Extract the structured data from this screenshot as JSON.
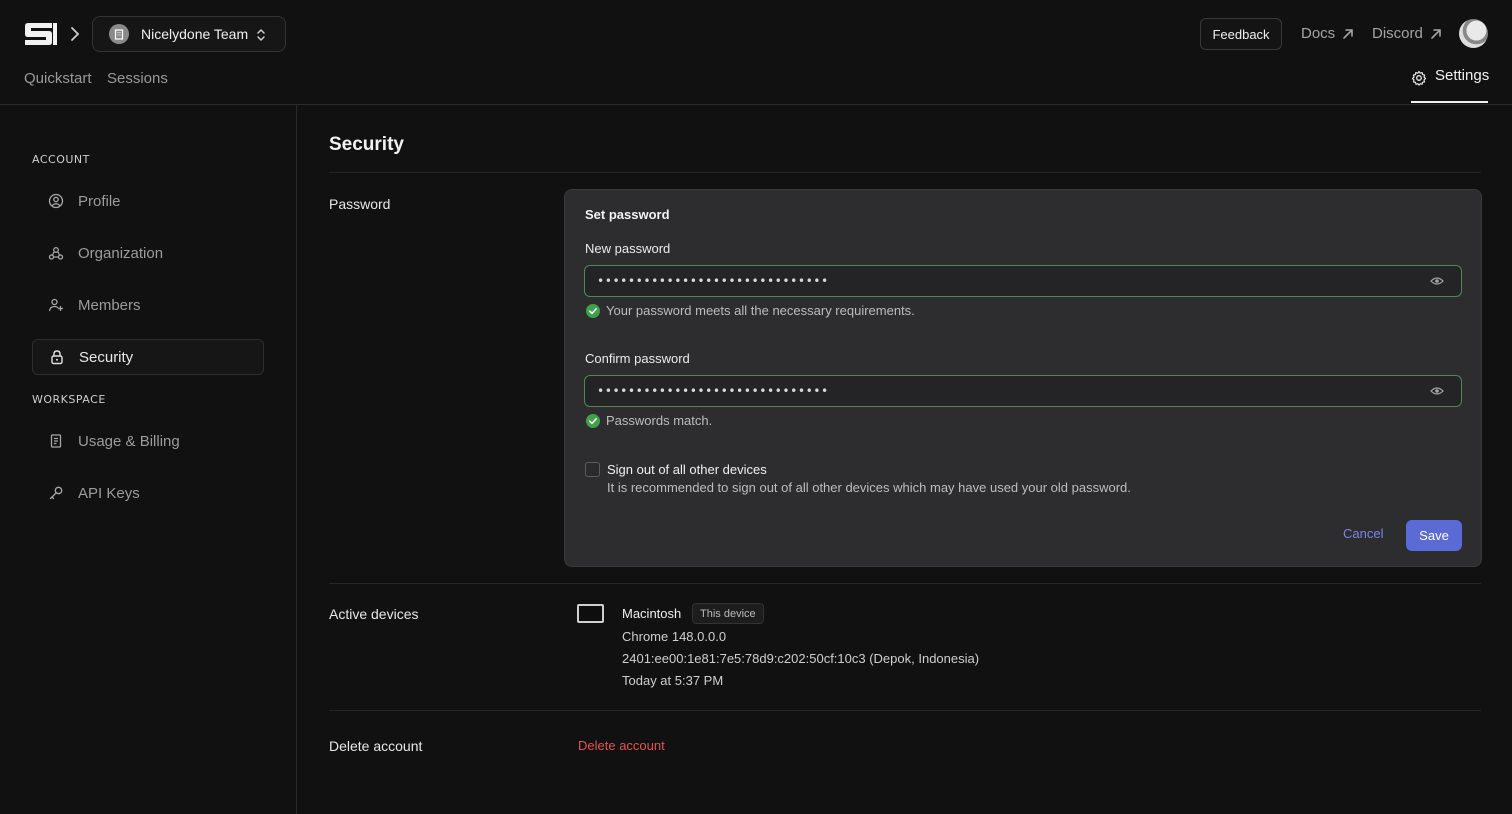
{
  "header": {
    "team_name": "Nicelydone Team",
    "feedback_label": "Feedback",
    "docs_label": "Docs",
    "discord_label": "Discord"
  },
  "tabs": {
    "quickstart": "Quickstart",
    "sessions": "Sessions",
    "settings": "Settings"
  },
  "sidebar": {
    "account_section": "ACCOUNT",
    "workspace_section": "WORKSPACE",
    "items": [
      {
        "label": "Profile",
        "icon": "user-circle-icon"
      },
      {
        "label": "Organization",
        "icon": "organization-icon"
      },
      {
        "label": "Members",
        "icon": "user-plus-icon"
      },
      {
        "label": "Security",
        "icon": "lock-icon",
        "active": true
      },
      {
        "label": "Usage & Billing",
        "icon": "receipt-icon"
      },
      {
        "label": "API Keys",
        "icon": "key-icon"
      }
    ]
  },
  "main": {
    "title": "Security",
    "password_row_label": "Password",
    "card": {
      "title": "Set password",
      "new_password_label": "New password",
      "new_password_value": "••••••••••••••••••••••••••••••",
      "new_password_hint": "Your password meets all the necessary requirements.",
      "confirm_password_label": "Confirm password",
      "confirm_password_value": "••••••••••••••••••••••••••••••",
      "confirm_password_hint": "Passwords match.",
      "signout_title": "Sign out of all other devices",
      "signout_desc": "It is recommended to sign out of all other devices which may have used your old password.",
      "cancel_label": "Cancel",
      "save_label": "Save"
    },
    "devices": {
      "row_label": "Active devices",
      "name": "Macintosh",
      "badge": "This device",
      "browser": "Chrome 148.0.0.0",
      "ip_location": "2401:ee00:1e81:7e5:78d9:c202:50cf:10c3 (Depok, Indonesia)",
      "last_active": "Today at 5:37 PM"
    },
    "delete": {
      "row_label": "Delete account",
      "link_label": "Delete account"
    }
  },
  "colors": {
    "background": "#111111",
    "card": "#2d2d2f",
    "accent": "#5b6bd6",
    "success": "#3fa14a",
    "danger": "#e55252"
  }
}
